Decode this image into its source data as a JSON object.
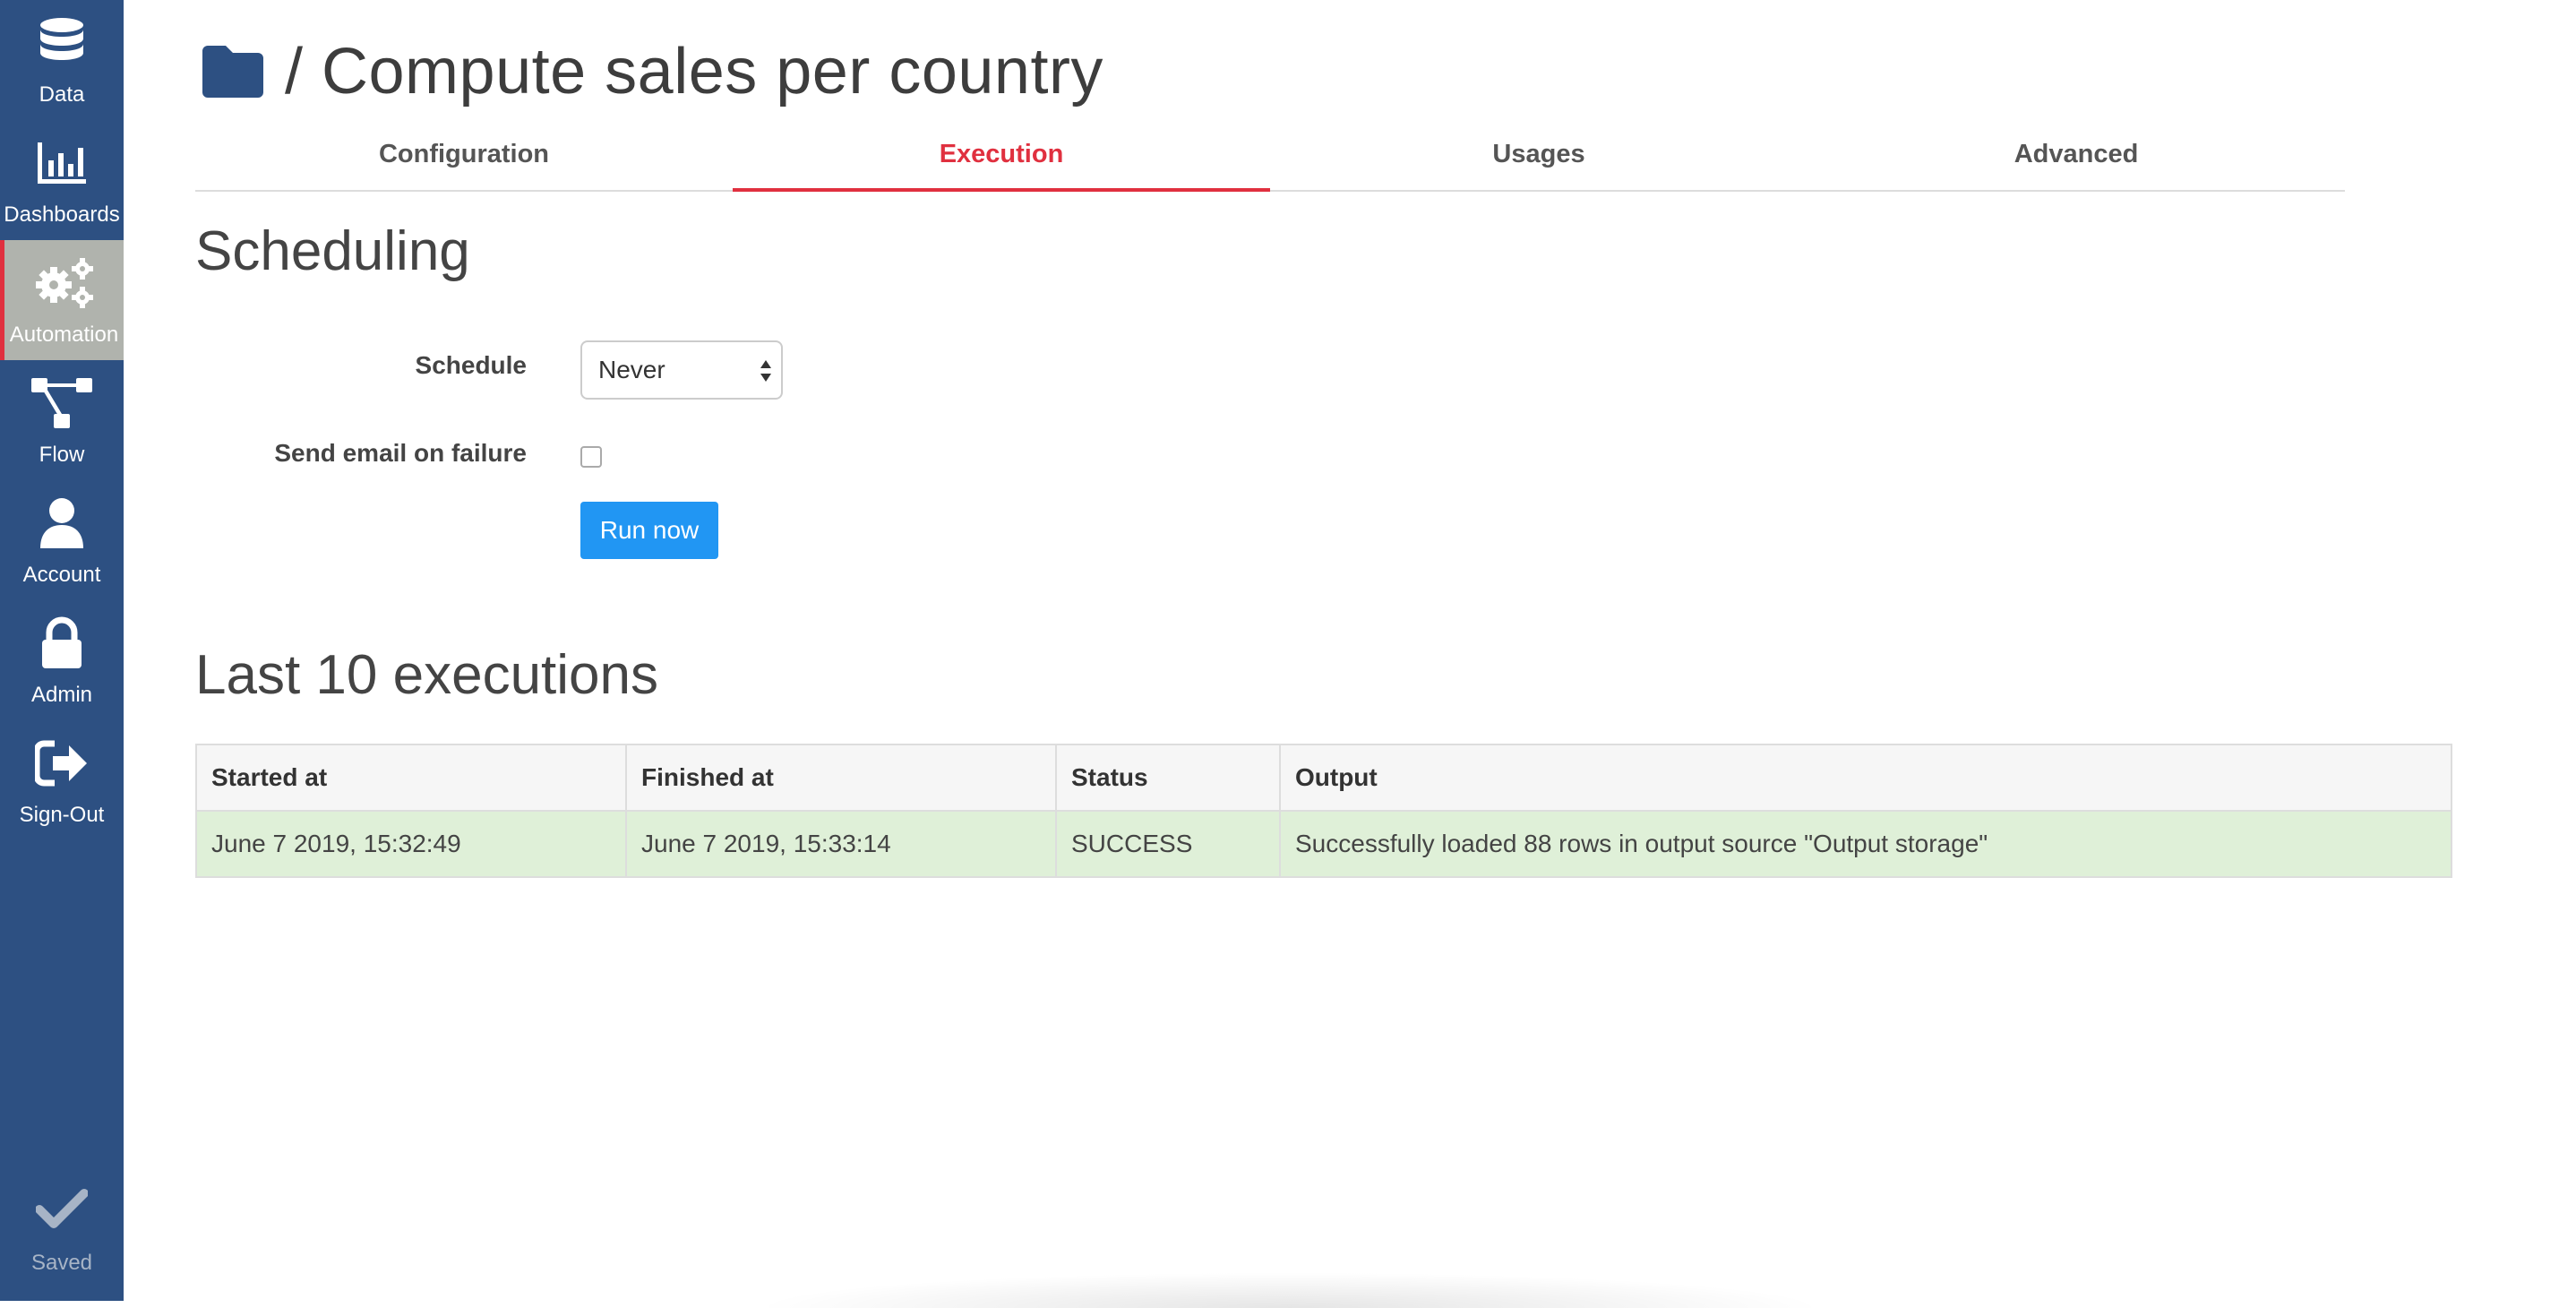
{
  "sidebar": {
    "items": [
      {
        "label": "Data",
        "icon": "database-icon"
      },
      {
        "label": "Dashboards",
        "icon": "bar-chart-icon"
      },
      {
        "label": "Automation",
        "icon": "gears-icon",
        "active": true
      },
      {
        "label": "Flow",
        "icon": "flow-icon"
      },
      {
        "label": "Account",
        "icon": "user-icon"
      },
      {
        "label": "Admin",
        "icon": "lock-icon"
      },
      {
        "label": "Sign-Out",
        "icon": "sign-out-icon"
      }
    ],
    "saved_label": "Saved"
  },
  "header": {
    "title": "/ Compute sales per country"
  },
  "tabs": [
    {
      "label": "Configuration"
    },
    {
      "label": "Execution",
      "active": true
    },
    {
      "label": "Usages"
    },
    {
      "label": "Advanced"
    }
  ],
  "scheduling": {
    "heading": "Scheduling",
    "schedule_label": "Schedule",
    "schedule_value": "Never",
    "email_label": "Send email on failure",
    "email_checked": false,
    "run_now_label": "Run now"
  },
  "executions": {
    "heading": "Last 10 executions",
    "columns": [
      "Started at",
      "Finished at",
      "Status",
      "Output"
    ],
    "rows": [
      [
        "June 7 2019, 15:32:49",
        "June 7 2019, 15:33:14",
        "SUCCESS",
        "Successfully loaded 88 rows in output source \"Output storage\""
      ]
    ]
  },
  "colors": {
    "sidebar_bg": "#2d5082",
    "accent_red": "#e0303f",
    "button_blue": "#2196f3",
    "success_row": "#dff0d8"
  }
}
